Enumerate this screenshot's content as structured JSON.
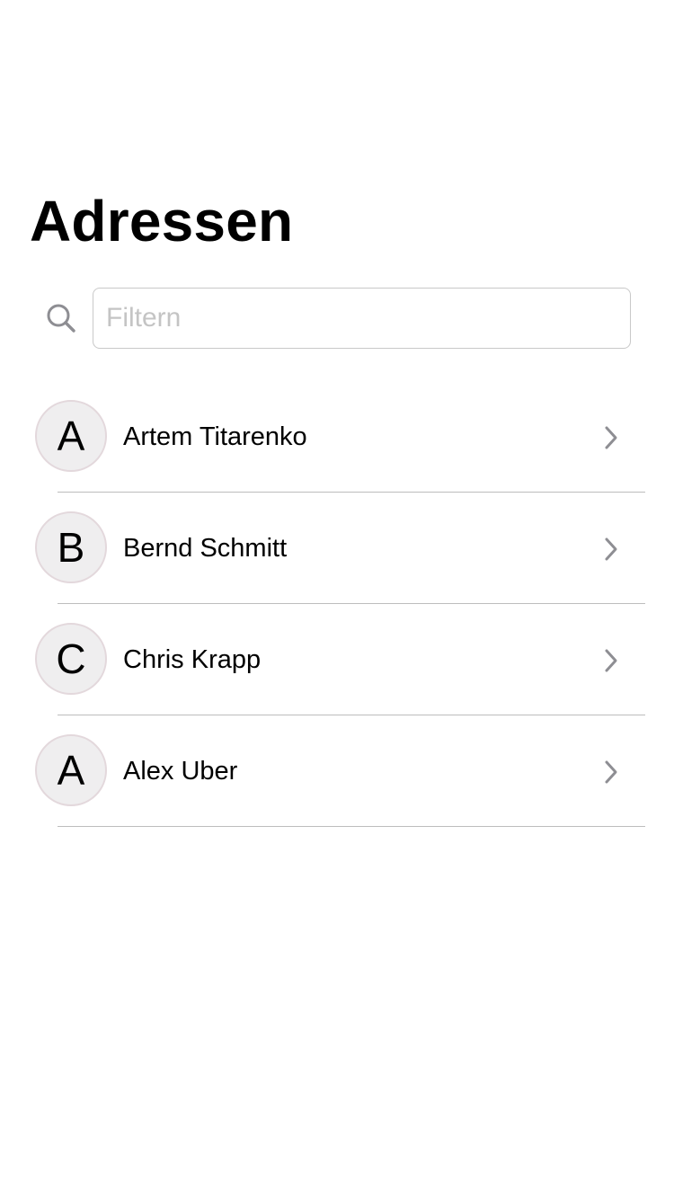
{
  "header": {
    "title": "Adressen"
  },
  "search": {
    "placeholder": "Filtern",
    "value": "",
    "icon": "search-icon"
  },
  "contacts": [
    {
      "initial": "A",
      "name": "Artem Titarenko"
    },
    {
      "initial": "B",
      "name": "Bernd Schmitt"
    },
    {
      "initial": "C",
      "name": "Chris Krapp"
    },
    {
      "initial": "A",
      "name": "Alex Uber"
    }
  ],
  "colors": {
    "avatar_bg": "#efeeef",
    "avatar_border": "#e3d8dc",
    "separator": "#bdbdbd",
    "chevron": "#8e8e93",
    "placeholder": "#c4c4c4"
  }
}
